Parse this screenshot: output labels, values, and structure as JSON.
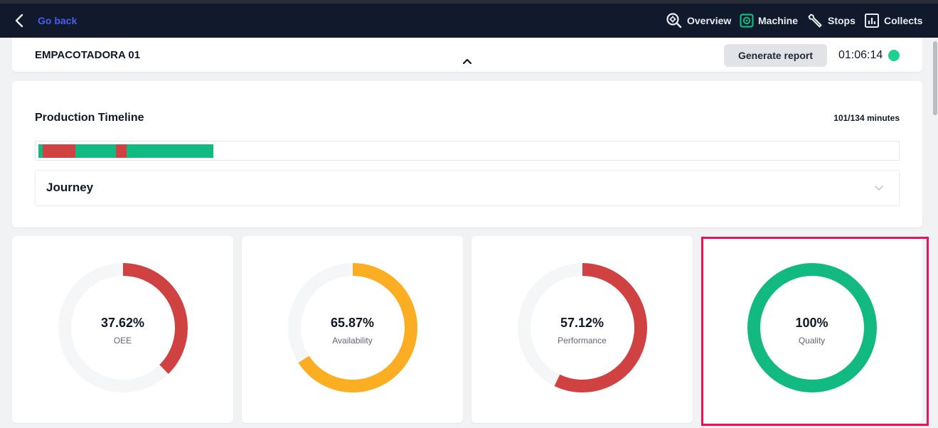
{
  "topbar": {
    "back_label": "Go back",
    "nav": [
      {
        "label": "Overview",
        "icon": "search-gear-icon"
      },
      {
        "label": "Machine",
        "icon": "machine-icon",
        "icon_color": "#12b981"
      },
      {
        "label": "Stops",
        "icon": "wrench-icon"
      },
      {
        "label": "Collects",
        "icon": "chart-icon"
      }
    ]
  },
  "header": {
    "machine_name": "EMPACOTADORA 01",
    "report_button": "Generate report",
    "clock": "01:06:14",
    "status_color": "#1ed18f"
  },
  "timeline": {
    "title": "Production Timeline",
    "minutes": "101/134 minutes",
    "segments": [
      {
        "state": "running",
        "color": "#12b981"
      },
      {
        "state": "stopped",
        "color": "#d04141"
      },
      {
        "state": "running",
        "color": "#12b981"
      },
      {
        "state": "stopped",
        "color": "#d04141"
      },
      {
        "state": "running",
        "color": "#12b981"
      }
    ],
    "journey_label": "Journey"
  },
  "gauges": [
    {
      "value": "37.62%",
      "label": "OEE",
      "fraction": 0.3762,
      "color": "#d04141"
    },
    {
      "value": "65.87%",
      "label": "Availability",
      "fraction": 0.6587,
      "color": "#fbae22"
    },
    {
      "value": "57.12%",
      "label": "Performance",
      "fraction": 0.5712,
      "color": "#d04141"
    },
    {
      "value": "100%",
      "label": "Quality",
      "fraction": 1.0,
      "color": "#12b981"
    }
  ],
  "colors": {
    "topbar_bg": "#111a2c",
    "link": "#4a5cf0",
    "highlight": "#ee1157",
    "gauge_track": "#f5f6f8"
  }
}
